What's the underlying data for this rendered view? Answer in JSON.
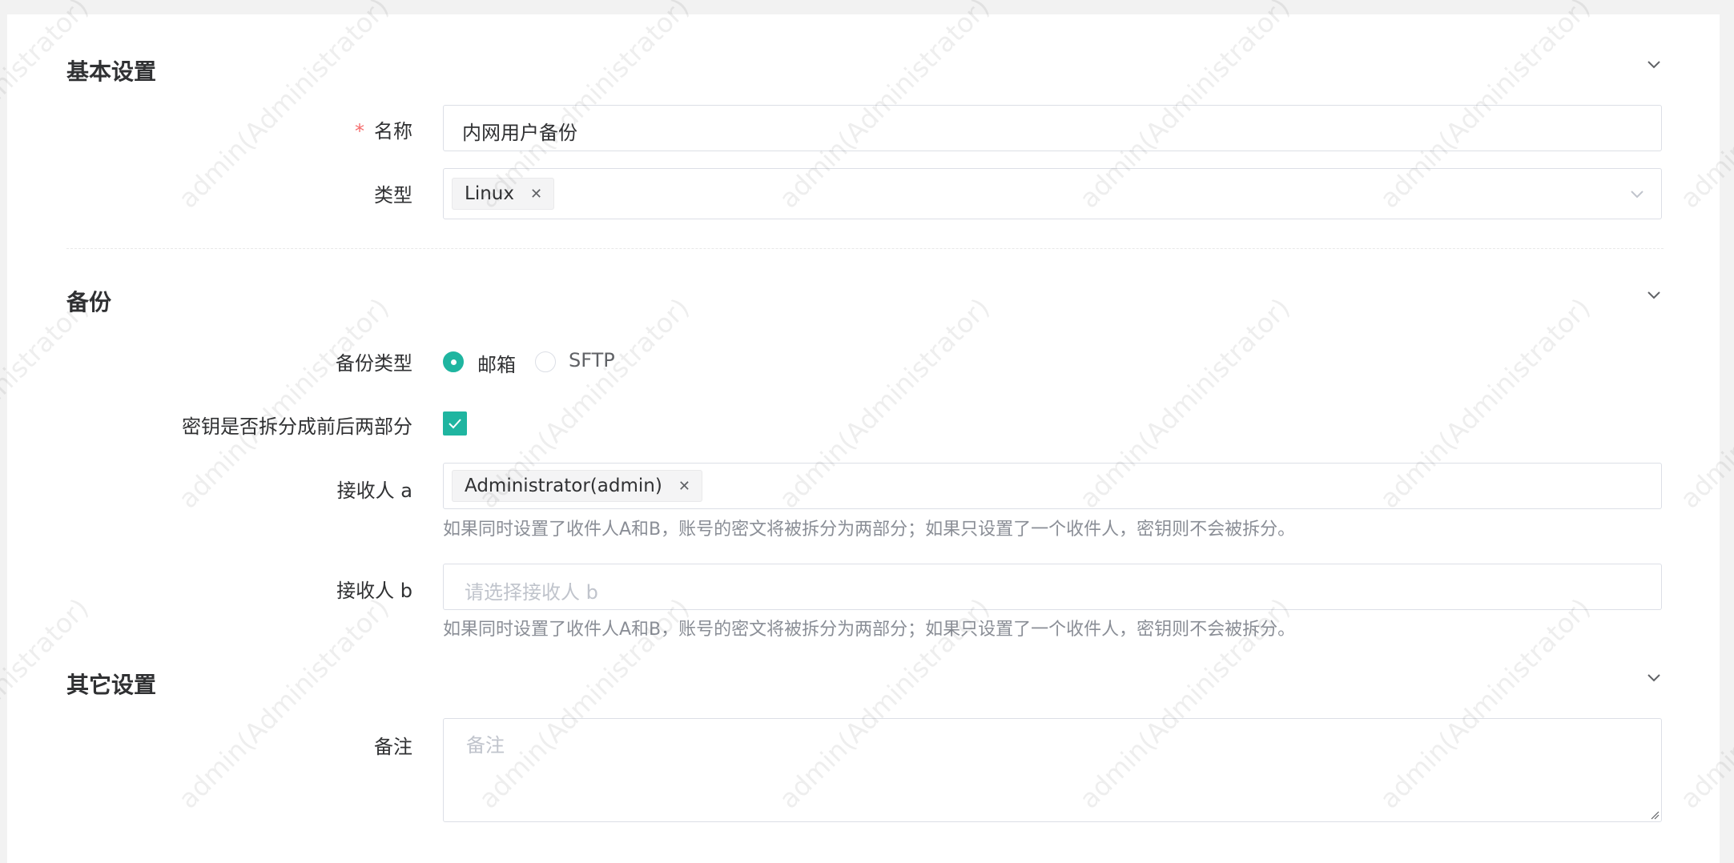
{
  "watermark": "admin(Administrator)",
  "sections": {
    "basic": {
      "title": "基本设置"
    },
    "backup": {
      "title": "备份"
    },
    "other": {
      "title": "其它设置"
    }
  },
  "fields": {
    "name": {
      "required_mark": "*",
      "label": "名称",
      "value": "内网用户备份"
    },
    "type": {
      "label": "类型",
      "tags": [
        "Linux"
      ]
    },
    "backup_type": {
      "label": "备份类型",
      "options": [
        "邮箱",
        "SFTP"
      ],
      "selected": "邮箱"
    },
    "split_key": {
      "label": "密钥是否拆分成前后两部分",
      "checked": true
    },
    "recipient_a": {
      "label": "接收人 a",
      "tags": [
        "Administrator(admin)"
      ],
      "hint": "如果同时设置了收件人A和B，账号的密文将被拆分为两部分；如果只设置了一个收件人，密钥则不会被拆分。"
    },
    "recipient_b": {
      "label": "接收人 b",
      "placeholder": "请选择接收人 b",
      "hint": "如果同时设置了收件人A和B，账号的密文将被拆分为两部分；如果只设置了一个收件人，密钥则不会被拆分。"
    },
    "remark": {
      "label": "备注",
      "placeholder": "备注"
    }
  },
  "colors": {
    "accent": "#1fb5a0",
    "required": "#f56c6c",
    "hint_text": "#8a8e96",
    "border": "#dcdfe6"
  },
  "icons": {
    "section_toggle": "chevron-down-icon",
    "select_arrow": "chevron-down-icon",
    "tag_remove": "close-icon",
    "checkbox_mark": "check-icon"
  }
}
